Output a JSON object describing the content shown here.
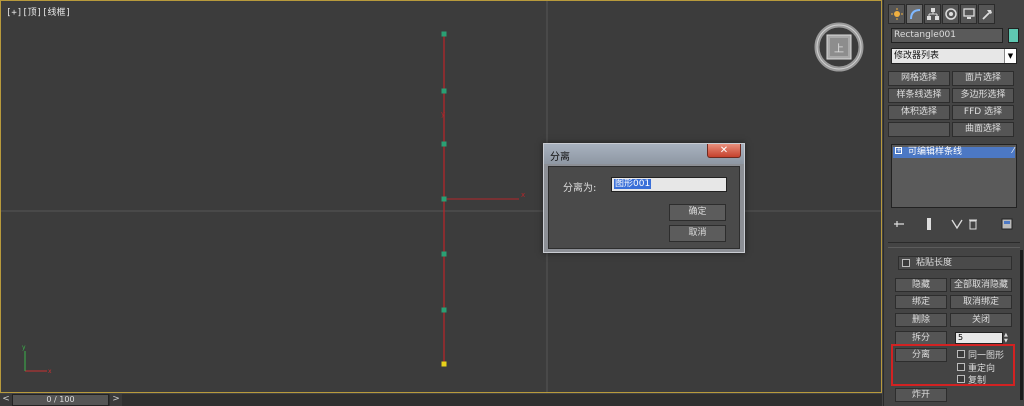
{
  "viewport": {
    "label": "[+][顶][线框]"
  },
  "viewcube": {
    "face_label": "上"
  },
  "dialog": {
    "title": "分离",
    "close_symbol": "✕",
    "name_label": "分离为:",
    "name_value": "图形001",
    "ok_label": "确定",
    "cancel_label": "取消"
  },
  "timeline": {
    "prev_symbol": "<",
    "frame_label": "0 / 100",
    "next_symbol": ">"
  },
  "panel": {
    "tabs": [
      {
        "icon": "sun-create-icon"
      },
      {
        "icon": "modify-arc-icon"
      },
      {
        "icon": "hierarchy-icon"
      },
      {
        "icon": "motion-icon"
      },
      {
        "icon": "display-monitor-icon"
      },
      {
        "icon": "utilities-hammer-icon"
      }
    ],
    "object_name": "Rectangle001",
    "object_color": "#5fc8b2",
    "modifier_list": "修改器列表",
    "modifier_buttons": [
      {
        "label": "网格选择"
      },
      {
        "label": "面片选择"
      },
      {
        "label": "样条线选择"
      },
      {
        "label": "多边形选择"
      },
      {
        "label": "体积选择"
      },
      {
        "label": "FFD 选择"
      },
      {
        "label": ""
      },
      {
        "label": "曲面选择"
      }
    ],
    "stack_item": "可编辑样条线",
    "sticky_label": "粘贴长度",
    "geometry": {
      "hide": "隐藏",
      "unhide_all": "全部取消隐藏",
      "bind": "绑定",
      "unbind": "取消绑定",
      "delete": "删除",
      "close": "关闭",
      "divide": "拆分",
      "divide_value": "5",
      "detach": "分离",
      "same_shape": "同一图形",
      "reorient": "重定向",
      "copy": "复制",
      "explode": "炸开"
    }
  }
}
